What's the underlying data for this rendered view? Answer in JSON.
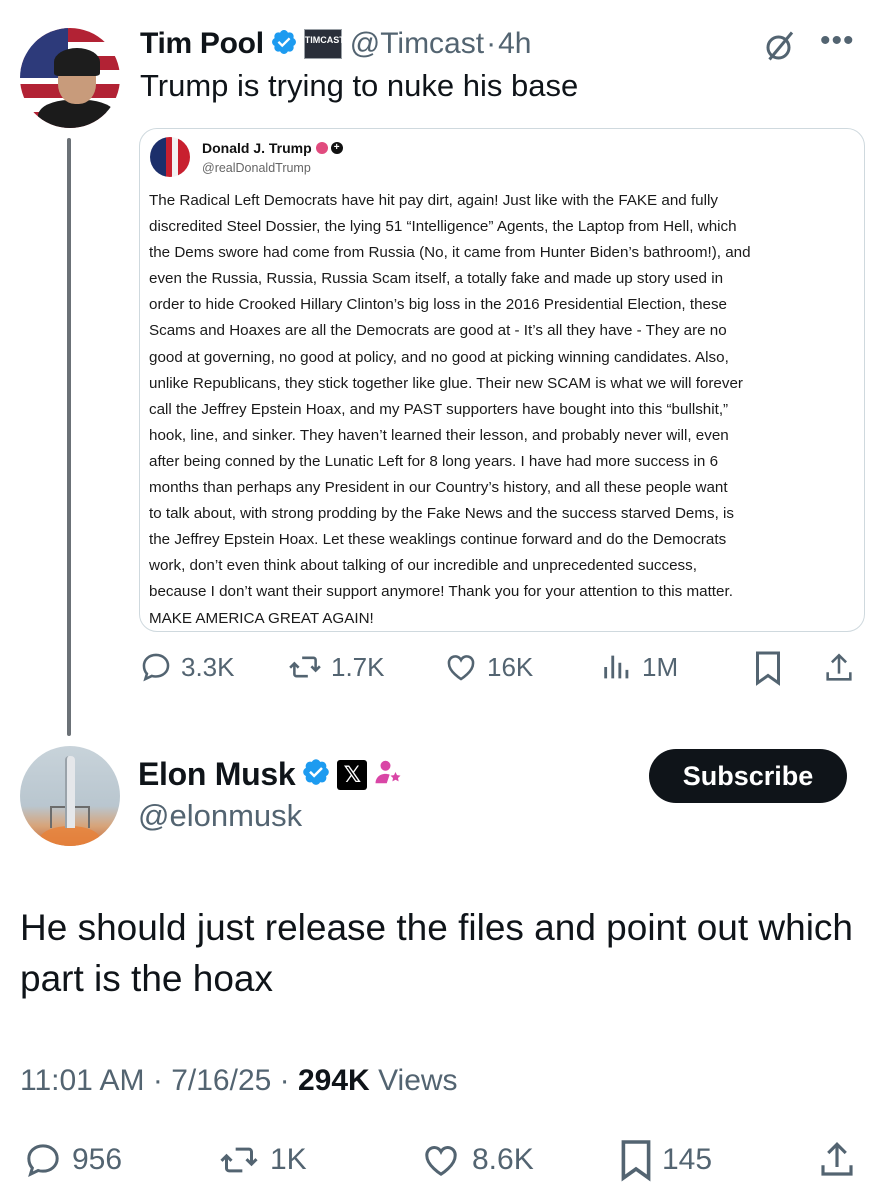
{
  "tweet1": {
    "author_name": "Tim Pool",
    "org_badge_text": "TIMCAST NEWS",
    "handle": "@Timcast",
    "separator": "·",
    "time": "4h",
    "text": "Trump is trying to nuke his base",
    "quote": {
      "name": "Donald J. Trump",
      "handle": "@realDonaldTrump",
      "body_lines": [
        "The Radical Left Democrats have hit pay dirt, again! Just like with the FAKE and fully",
        "discredited Steel Dossier, the lying 51 “Intelligence” Agents, the Laptop from Hell, which",
        "the Dems swore had come from Russia (No, it came from Hunter Biden’s bathroom!), and",
        "even the Russia, Russia, Russia Scam itself, a totally fake and made up story used in",
        "order to hide Crooked Hillary Clinton’s big loss in the 2016 Presidential Election, these",
        "Scams and Hoaxes are all the Democrats are good at - It’s all they have - They are no",
        "good at governing, no good at policy, and no good at picking winning candidates. Also,",
        "unlike Republicans, they stick together like glue. Their new SCAM is what we will forever",
        "call the Jeffrey Epstein Hoax, and my PAST supporters have bought into this “bullshit,”",
        "hook, line, and sinker. They haven’t learned their lesson, and probably never will, even",
        "after being conned by the Lunatic Left for 8 long years. I have had more success in 6",
        "months than perhaps any President in our Country’s history, and all these people want",
        "to talk about, with strong prodding by the Fake News and the  success starved Dems, is",
        "the Jeffrey Epstein Hoax. Let these weaklings continue forward and do the Democrats",
        "work, don’t even think about talking of our incredible and unprecedented success,",
        "because I don’t want their support anymore! Thank you for your attention to this matter.",
        "MAKE AMERICA GREAT AGAIN!"
      ]
    },
    "stats": {
      "replies": "3.3K",
      "reposts": "1.7K",
      "likes": "16K",
      "views": "1M"
    }
  },
  "tweet2": {
    "author_name": "Elon Musk",
    "x_badge": "𝕏",
    "handle": "@elonmusk",
    "subscribe_label": "Subscribe",
    "text": "He should just release the files and point out which part is the hoax",
    "time": "11:01 AM",
    "separator": "·",
    "date": "7/16/25",
    "views_count": "294K",
    "views_label": "Views",
    "stats": {
      "replies": "956",
      "reposts": "1K",
      "likes": "8.6K",
      "bookmarks": "145"
    }
  },
  "colors": {
    "verified_blue": "#1d9bf0",
    "secondary_text": "#536471",
    "primary_text": "#0f1419",
    "affiliate_pink": "#d946a6"
  },
  "icons": [
    "grok-icon",
    "more-icon",
    "reply-icon",
    "repost-icon",
    "like-icon",
    "views-icon",
    "bookmark-icon",
    "share-icon",
    "verified-badge-icon",
    "affiliate-icon"
  ]
}
